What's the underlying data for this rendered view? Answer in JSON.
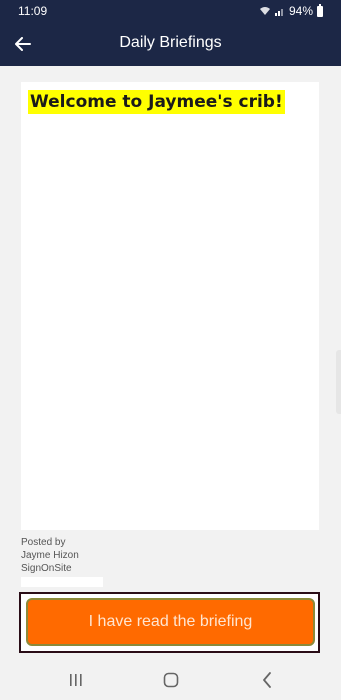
{
  "status_bar": {
    "time": "11:09",
    "battery": "94%"
  },
  "app_bar": {
    "title": "Daily Briefings"
  },
  "briefing": {
    "heading": "Welcome to Jaymee's crib!"
  },
  "posted": {
    "label": "Posted by",
    "author": "Jayme Hizon",
    "company": "SignOnSite"
  },
  "actions": {
    "read_button": "I have read the briefing"
  },
  "nav_bar": {
    "recent_icon": "recent-apps-icon",
    "home_icon": "home-icon",
    "back_icon": "back-nav-icon"
  },
  "colors": {
    "header": "#1c2746",
    "accent": "#ff6a00",
    "highlight": "#ffff00"
  }
}
